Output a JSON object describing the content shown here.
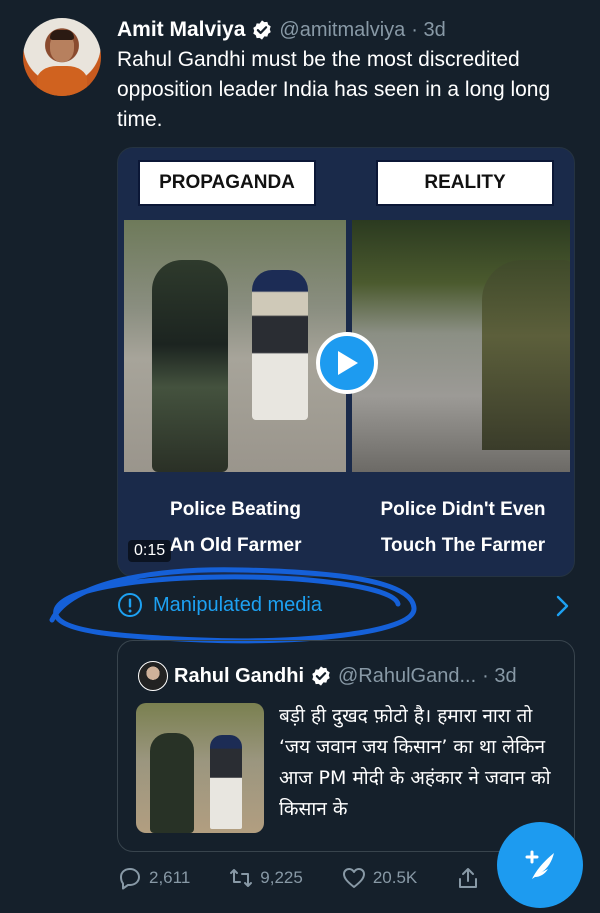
{
  "tweet": {
    "author_name": "Amit Malviya",
    "author_handle": "@amitmalviya",
    "time": "· 3d",
    "text": "Rahul Gandhi must be the most discredited opposition leader India has seen in a long long time."
  },
  "media": {
    "left_label": "PROPAGANDA",
    "right_label": "REALITY",
    "left_caption_line1": "Police Beating",
    "left_caption_line2": "An Old Farmer",
    "right_caption_line1": "Police Didn't Even",
    "right_caption_line2": "Touch The Farmer",
    "duration": "0:15"
  },
  "notice": {
    "label": "Manipulated media",
    "accent_color": "#1da1f2",
    "scribble_color": "#1560d8"
  },
  "quote": {
    "author_name": "Rahul Gandhi",
    "author_handle": "@RahulGand...",
    "time": "· 3d",
    "text": "बड़ी ही दुखद फ़ोटो है। हमारा नारा तो ‘जय जवान जय किसान’ का था लेकिन आज PM मोदी के अहंकार ने जवान को किसान के"
  },
  "actions": {
    "reply_count": "2,611",
    "retweet_count": "9,225",
    "like_count": "20.5K",
    "icons": [
      "reply-icon",
      "retweet-icon",
      "like-icon",
      "share-icon"
    ]
  },
  "fab": {
    "icon": "compose-icon",
    "color": "#1d9bf0"
  },
  "colors": {
    "background": "#15202b",
    "secondary_text": "#8899a6",
    "verified_badge": "#ffffff"
  }
}
